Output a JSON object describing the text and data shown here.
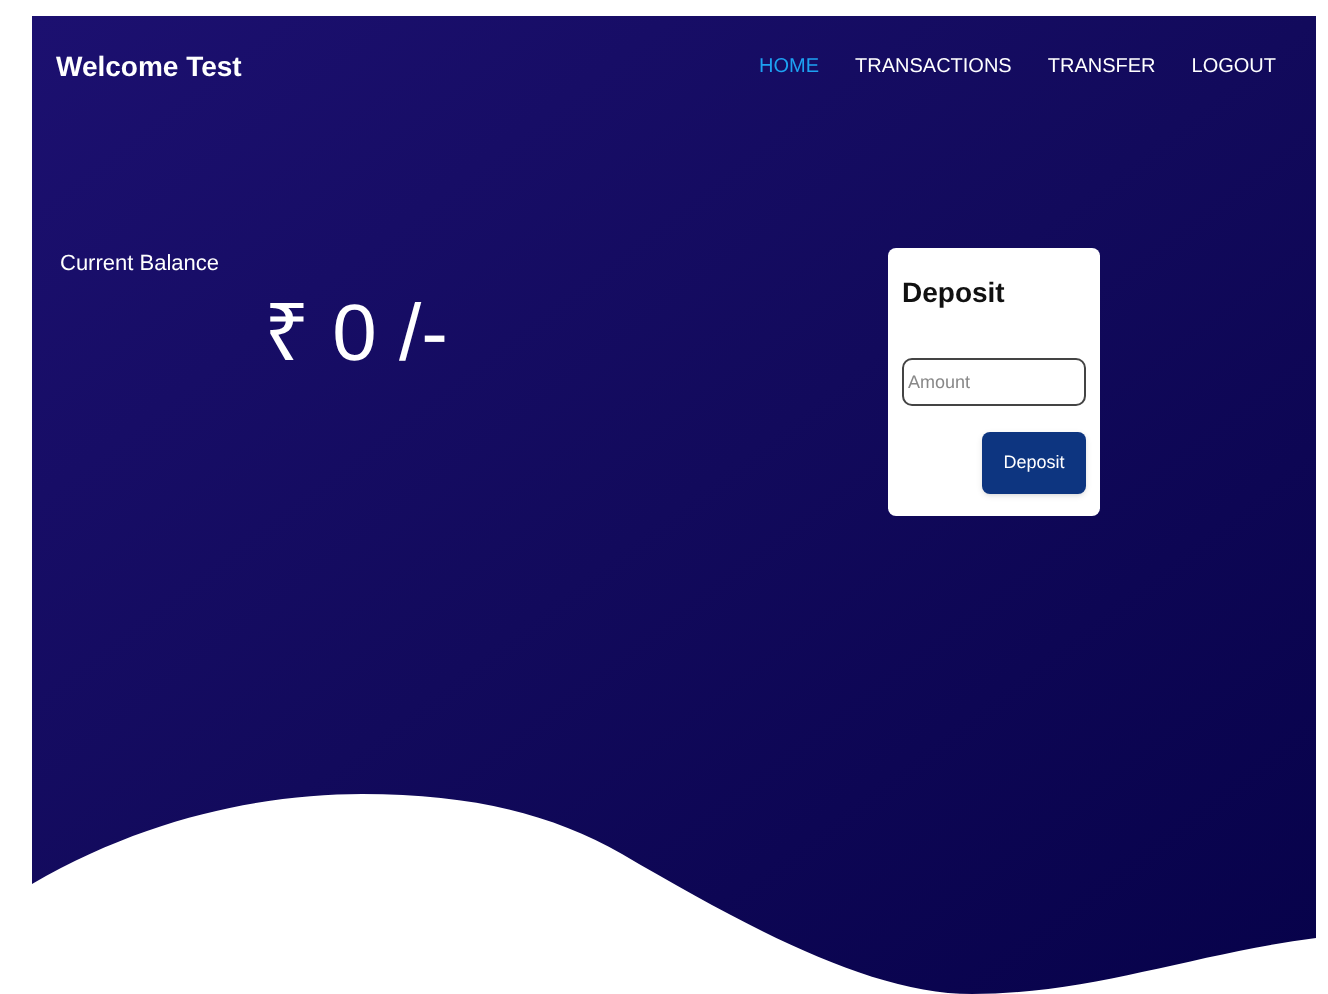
{
  "header": {
    "title": "Welcome Test"
  },
  "nav": [
    {
      "label": "HOME",
      "selected": true
    },
    {
      "label": "TRANSACTIONS",
      "selected": false
    },
    {
      "label": "TRANSFER",
      "selected": false
    },
    {
      "label": "LOGOUT",
      "selected": false
    }
  ],
  "balance": {
    "label": "Current Balance",
    "amount": "₹ 0 /-"
  },
  "deposit_card": {
    "title": "Deposit",
    "amount_field": {
      "placeholder": "Amount"
    },
    "button": "Deposit"
  }
}
